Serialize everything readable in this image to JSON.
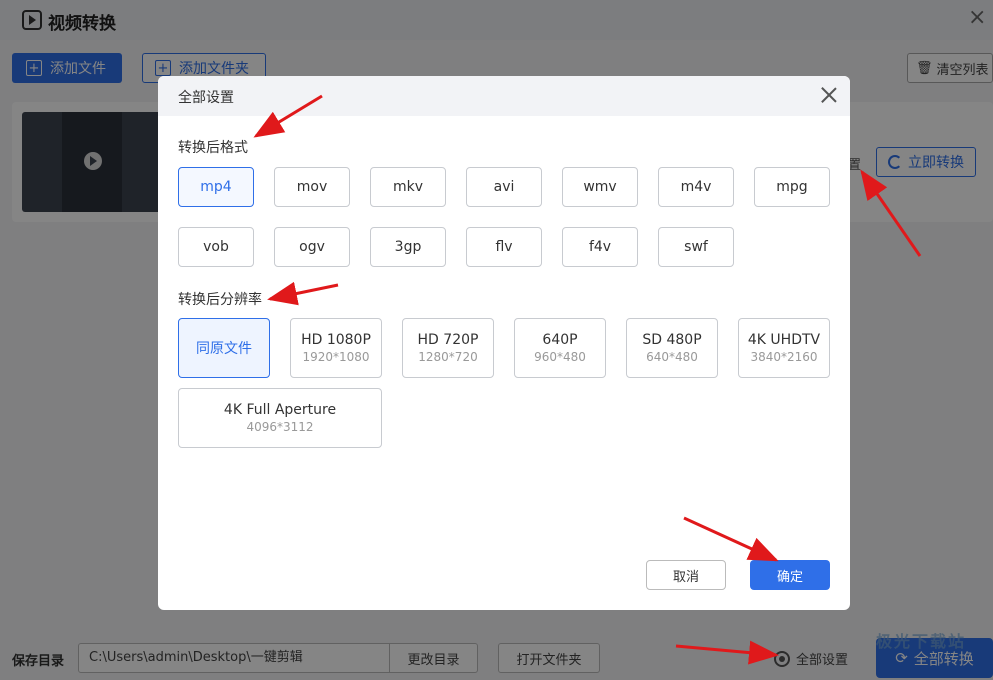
{
  "app": {
    "title": "视频转换",
    "add_file_label": "添加文件",
    "add_folder_label": "添加文件夹",
    "clear_list_label": "清空列表",
    "card_settings_partial": "置",
    "convert_now_label": "立即转换",
    "save_dir_label": "保存目录",
    "save_dir_path": "C:\\Users\\admin\\Desktop\\一键剪辑",
    "change_dir_label": "更改目录",
    "open_folder_label": "打开文件夹",
    "all_settings_label": "全部设置",
    "convert_all_label": "全部转换",
    "watermark_text": "极光下载站"
  },
  "dialog": {
    "title": "全部设置",
    "format_section_label": "转换后格式",
    "formats": [
      "mp4",
      "mov",
      "mkv",
      "avi",
      "wmv",
      "m4v",
      "mpg",
      "vob",
      "ogv",
      "3gp",
      "flv",
      "f4v",
      "swf"
    ],
    "selected_format": "mp4",
    "resolution_section_label": "转换后分辨率",
    "resolutions": [
      {
        "name": "同原文件",
        "size": ""
      },
      {
        "name": "HD 1080P",
        "size": "1920*1080"
      },
      {
        "name": "HD 720P",
        "size": "1280*720"
      },
      {
        "name": "640P",
        "size": "960*480"
      },
      {
        "name": "SD 480P",
        "size": "640*480"
      },
      {
        "name": "4K UHDTV",
        "size": "3840*2160"
      },
      {
        "name": "4K Full Aperture",
        "size": "4096*3112"
      }
    ],
    "selected_resolution": "同原文件",
    "cancel_label": "取消",
    "ok_label": "确定"
  },
  "colors": {
    "accent": "#2f6fe8",
    "annotation_arrow": "#e0191b"
  }
}
